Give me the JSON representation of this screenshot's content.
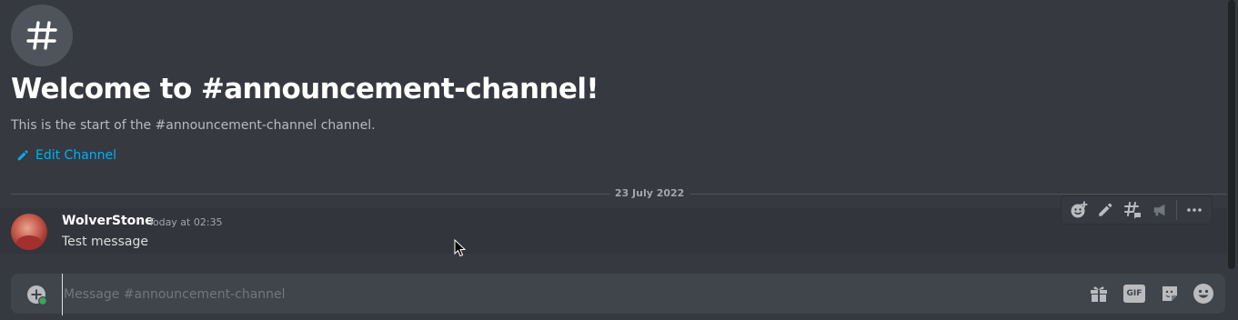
{
  "channel": {
    "welcome_title": "Welcome to #announcement-channel!",
    "welcome_subtitle": "This is the start of the #announcement-channel channel.",
    "edit_label": "Edit Channel",
    "icon": "hashtag-icon"
  },
  "divider": {
    "date": "23 July 2022"
  },
  "message": {
    "username": "WolverStone",
    "timestamp": "Today at 02:35",
    "text": "Test message"
  },
  "message_toolbar": {
    "icons": [
      "add-reaction-icon",
      "edit-icon",
      "create-thread-icon",
      "publish-icon",
      "more-icon"
    ]
  },
  "composer": {
    "placeholder": "Message #announcement-channel",
    "value": "",
    "icons": [
      "attach-plus-icon",
      "gift-icon",
      "gif-icon",
      "sticker-icon",
      "emoji-icon"
    ],
    "gif_label": "GIF"
  },
  "colors": {
    "background": "#36393f",
    "link": "#00aff4",
    "input_background": "#40444b",
    "status_online": "#3ba55d"
  }
}
